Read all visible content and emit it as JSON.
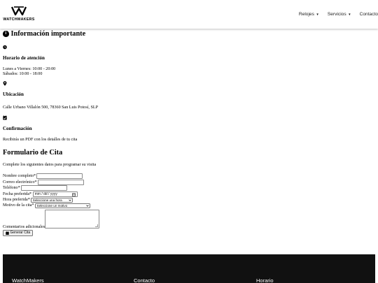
{
  "header": {
    "logo_text": "WATCHMAKERS",
    "nav": [
      {
        "label": "Relojes",
        "caret": "▼"
      },
      {
        "label": "Servicios",
        "caret": "▼"
      },
      {
        "label": "Contacto"
      }
    ]
  },
  "info": {
    "title": "Información importante",
    "info_icon": "i",
    "hours": {
      "icon": "clock-icon",
      "heading": "Horario de atención",
      "weekdays": "Lunes a Viernes: 10:00 - 20:00",
      "saturdays": "Sábados: 10:00 - 18:00"
    },
    "location": {
      "icon": "map-pin-icon",
      "heading": "Ubicación",
      "address": "Calle Urbano Villalón 500, 78360 San Luis Potosí, SLP"
    },
    "confirmation": {
      "icon": "calendar-check-icon",
      "heading": "Confirmación",
      "text": "Recibirás un PDF con los detalles de tu cita"
    }
  },
  "form": {
    "title": "Formulario de Cita",
    "intro": "Complete los siguientes datos para programar su visita",
    "name_label": "Nombre completo*",
    "email_label": "Correo electrónico*",
    "phone_label": "Teléfono*",
    "date_label": "Fecha preferida*",
    "date_placeholder": "mm / dd / yyyy",
    "time_label": "Hora preferida*",
    "time_value": "Seleccione una hora",
    "reason_label": "Motivo de la cita*",
    "reason_value": "Seleccione un motivo",
    "comments_label": "Comentarios adicionales",
    "submit_label": "Generar Cita"
  },
  "footer": {
    "col1": "WatchMakers",
    "col2": "Contacto",
    "col3": "Horario"
  }
}
